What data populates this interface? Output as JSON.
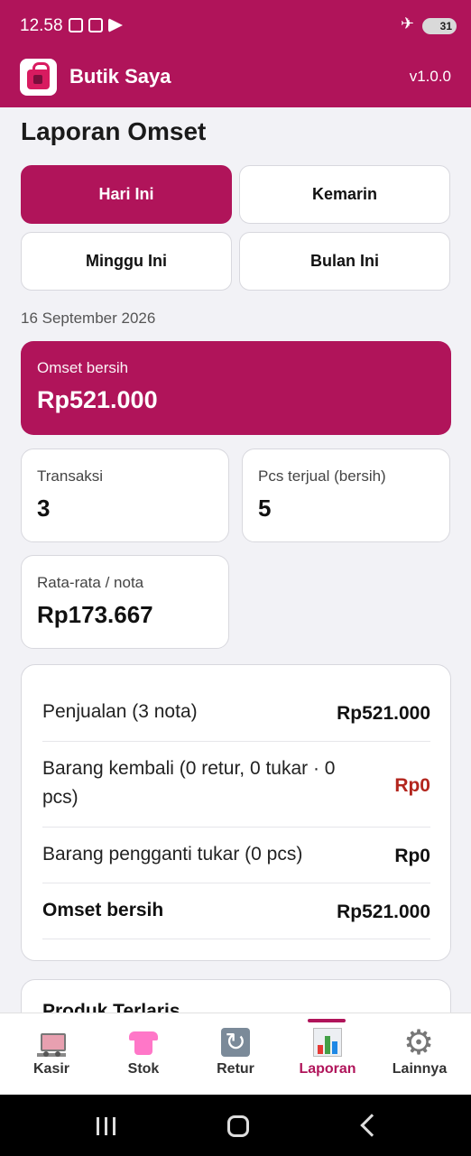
{
  "status_bar": {
    "time": "12.58",
    "battery": "31"
  },
  "app_bar": {
    "title": "Butik Saya",
    "version": "v1.0.0"
  },
  "page": {
    "title": "Laporan Omset",
    "periods": [
      {
        "label": "Hari Ini",
        "active": true
      },
      {
        "label": "Kemarin",
        "active": false
      },
      {
        "label": "Minggu Ini",
        "active": false
      },
      {
        "label": "Bulan Ini",
        "active": false
      }
    ],
    "date": "16 September 2026",
    "hero": {
      "label": "Omset bersih",
      "value": "Rp521.000"
    },
    "stats": {
      "transaksi": {
        "label": "Transaksi",
        "value": "3"
      },
      "pcs": {
        "label": "Pcs terjual (bersih)",
        "value": "5"
      },
      "rata": {
        "label": "Rata-rata / nota",
        "value": "Rp173.667"
      }
    },
    "summary": [
      {
        "label": "Penjualan (3 nota)",
        "value": "Rp521.000"
      },
      {
        "label": "Barang kembali (0 retur, 0 tukar · 0 pcs)",
        "value": "Rp0"
      },
      {
        "label": "Barang pengganti tukar (0 pcs)",
        "value": "Rp0"
      },
      {
        "label": "Omset bersih",
        "value": "Rp521.000"
      }
    ],
    "next_section_title": "Produk Terlaris"
  },
  "bottom_nav": [
    {
      "label": "Kasir",
      "icon": "cart-icon"
    },
    {
      "label": "Stok",
      "icon": "shirt-icon"
    },
    {
      "label": "Retur",
      "icon": "retur-icon"
    },
    {
      "label": "Laporan",
      "icon": "chart-icon",
      "active": true
    },
    {
      "label": "Lainnya",
      "icon": "gear-icon"
    }
  ],
  "colors": {
    "brand": "#b0145a",
    "negative": "#b3261e",
    "background": "#f2f2f6"
  }
}
